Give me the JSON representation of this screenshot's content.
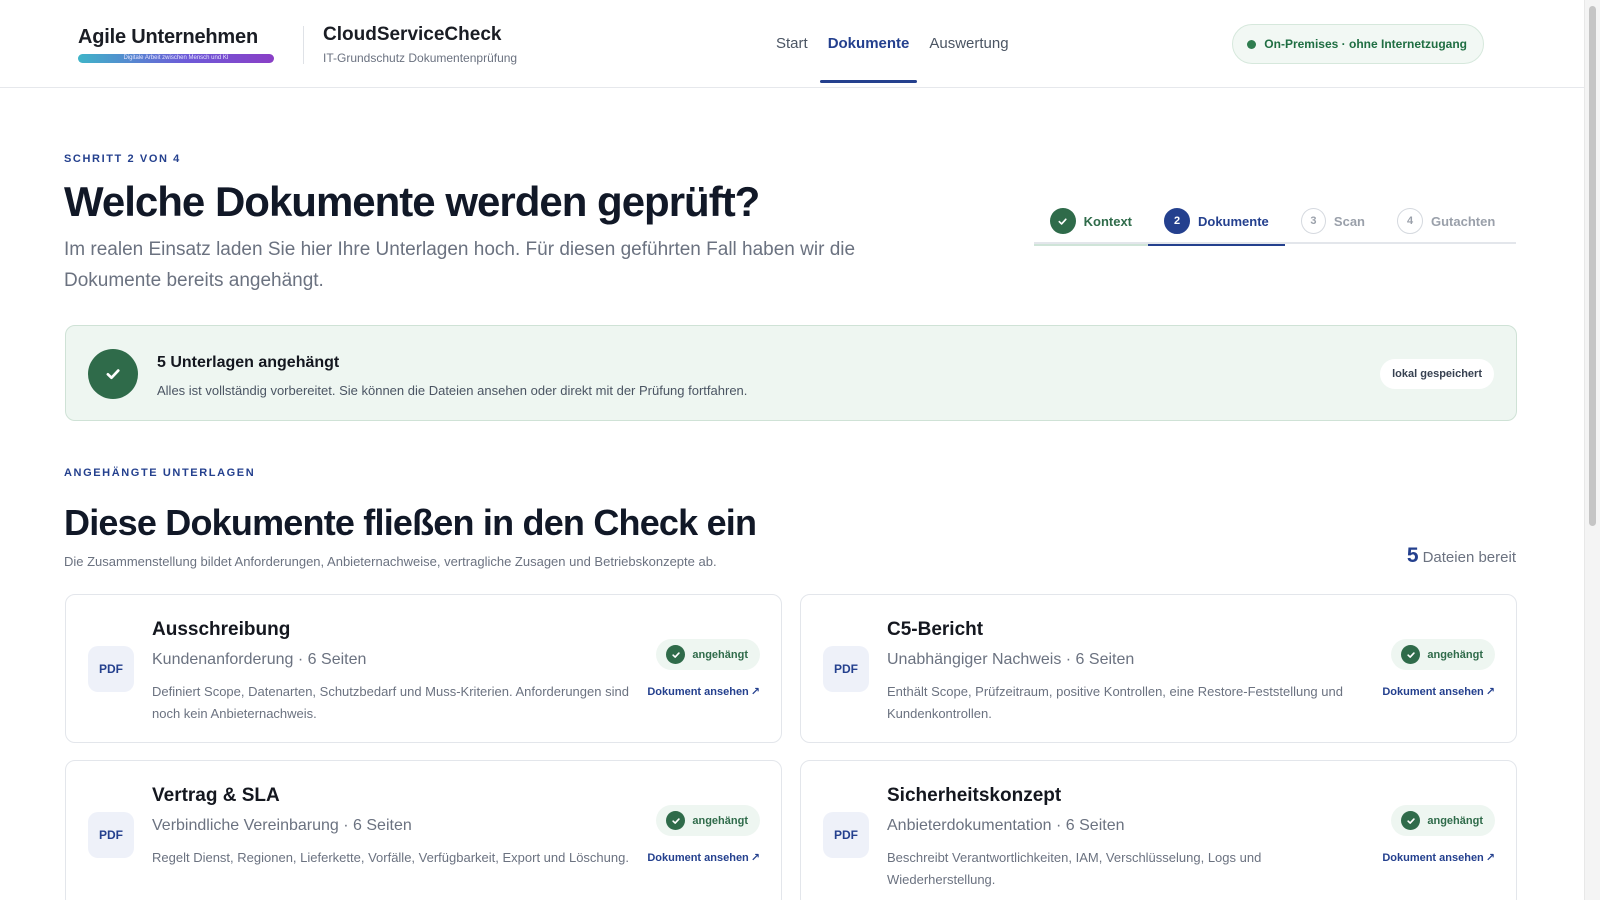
{
  "header": {
    "brand_name": "Agile Unternehmen",
    "brand_tagline": "Digitale Arbeit zwischen Mensch und KI",
    "product_name": "CloudServiceCheck",
    "product_subtitle": "IT-Grundschutz Dokumentenprüfung",
    "nav": [
      {
        "label": "Start",
        "active": false
      },
      {
        "label": "Dokumente",
        "active": true
      },
      {
        "label": "Auswertung",
        "active": false
      }
    ],
    "status": "On-Premises · ohne Internetzugang"
  },
  "intro": {
    "eyebrow": "SCHRITT 2 VON 4",
    "title": "Welche Dokumente werden geprüft?",
    "lead": "Im realen Einsatz laden Sie hier Ihre Unterlagen hoch. Für diesen geführten Fall haben wir die Dokumente bereits angehängt."
  },
  "stepper": [
    {
      "num": "1",
      "label": "Kontext",
      "state": "done"
    },
    {
      "num": "2",
      "label": "Dokumente",
      "state": "active"
    },
    {
      "num": "3",
      "label": "Scan",
      "state": "todo"
    },
    {
      "num": "4",
      "label": "Gutachten",
      "state": "todo"
    }
  ],
  "banner": {
    "title": "5 Unterlagen angehängt",
    "text": "Alles ist vollständig vorbereitet. Sie können die Dateien ansehen oder direkt mit der Prüfung fortfahren.",
    "badge": "lokal gespeichert"
  },
  "documents_section": {
    "eyebrow": "ANGEHÄNGTE UNTERLAGEN",
    "title": "Diese Dokumente fließen in den Check ein",
    "subtitle": "Die Zusammenstellung bildet Anforderungen, Anbieternachweise, vertragliche Zusagen und Betriebskonzepte ab.",
    "count": "5",
    "count_label": "Dateien bereit"
  },
  "documents": [
    {
      "type": "PDF",
      "title": "Ausschreibung",
      "meta": "Kundenanforderung · 6 Seiten",
      "description": "Definiert Scope, Datenarten, Schutzbedarf und Muss-Kriterien. Anforderungen sind noch kein Anbieternachweis.",
      "status": "angehängt",
      "link": "Dokument ansehen"
    },
    {
      "type": "PDF",
      "title": "C5-Bericht",
      "meta": "Unabhängiger Nachweis · 6 Seiten",
      "description": "Enthält Scope, Prüfzeitraum, positive Kontrollen, eine Restore-Feststellung und Kundenkontrollen.",
      "status": "angehängt",
      "link": "Dokument ansehen"
    },
    {
      "type": "PDF",
      "title": "Vertrag & SLA",
      "meta": "Verbindliche Vereinbarung · 6 Seiten",
      "description": "Regelt Dienst, Regionen, Lieferkette, Vorfälle, Verfügbarkeit, Export und Löschung.",
      "status": "angehängt",
      "link": "Dokument ansehen"
    },
    {
      "type": "PDF",
      "title": "Sicherheitskonzept",
      "meta": "Anbieterdokumentation · 6 Seiten",
      "description": "Beschreibt Verantwortlichkeiten, IAM, Verschlüsselung, Logs und Wiederherstellung.",
      "status": "angehängt",
      "link": "Dokument ansehen"
    }
  ],
  "colors": {
    "accent": "#24408e",
    "success": "#2f6b4a",
    "success_bg": "#eef6f1"
  }
}
